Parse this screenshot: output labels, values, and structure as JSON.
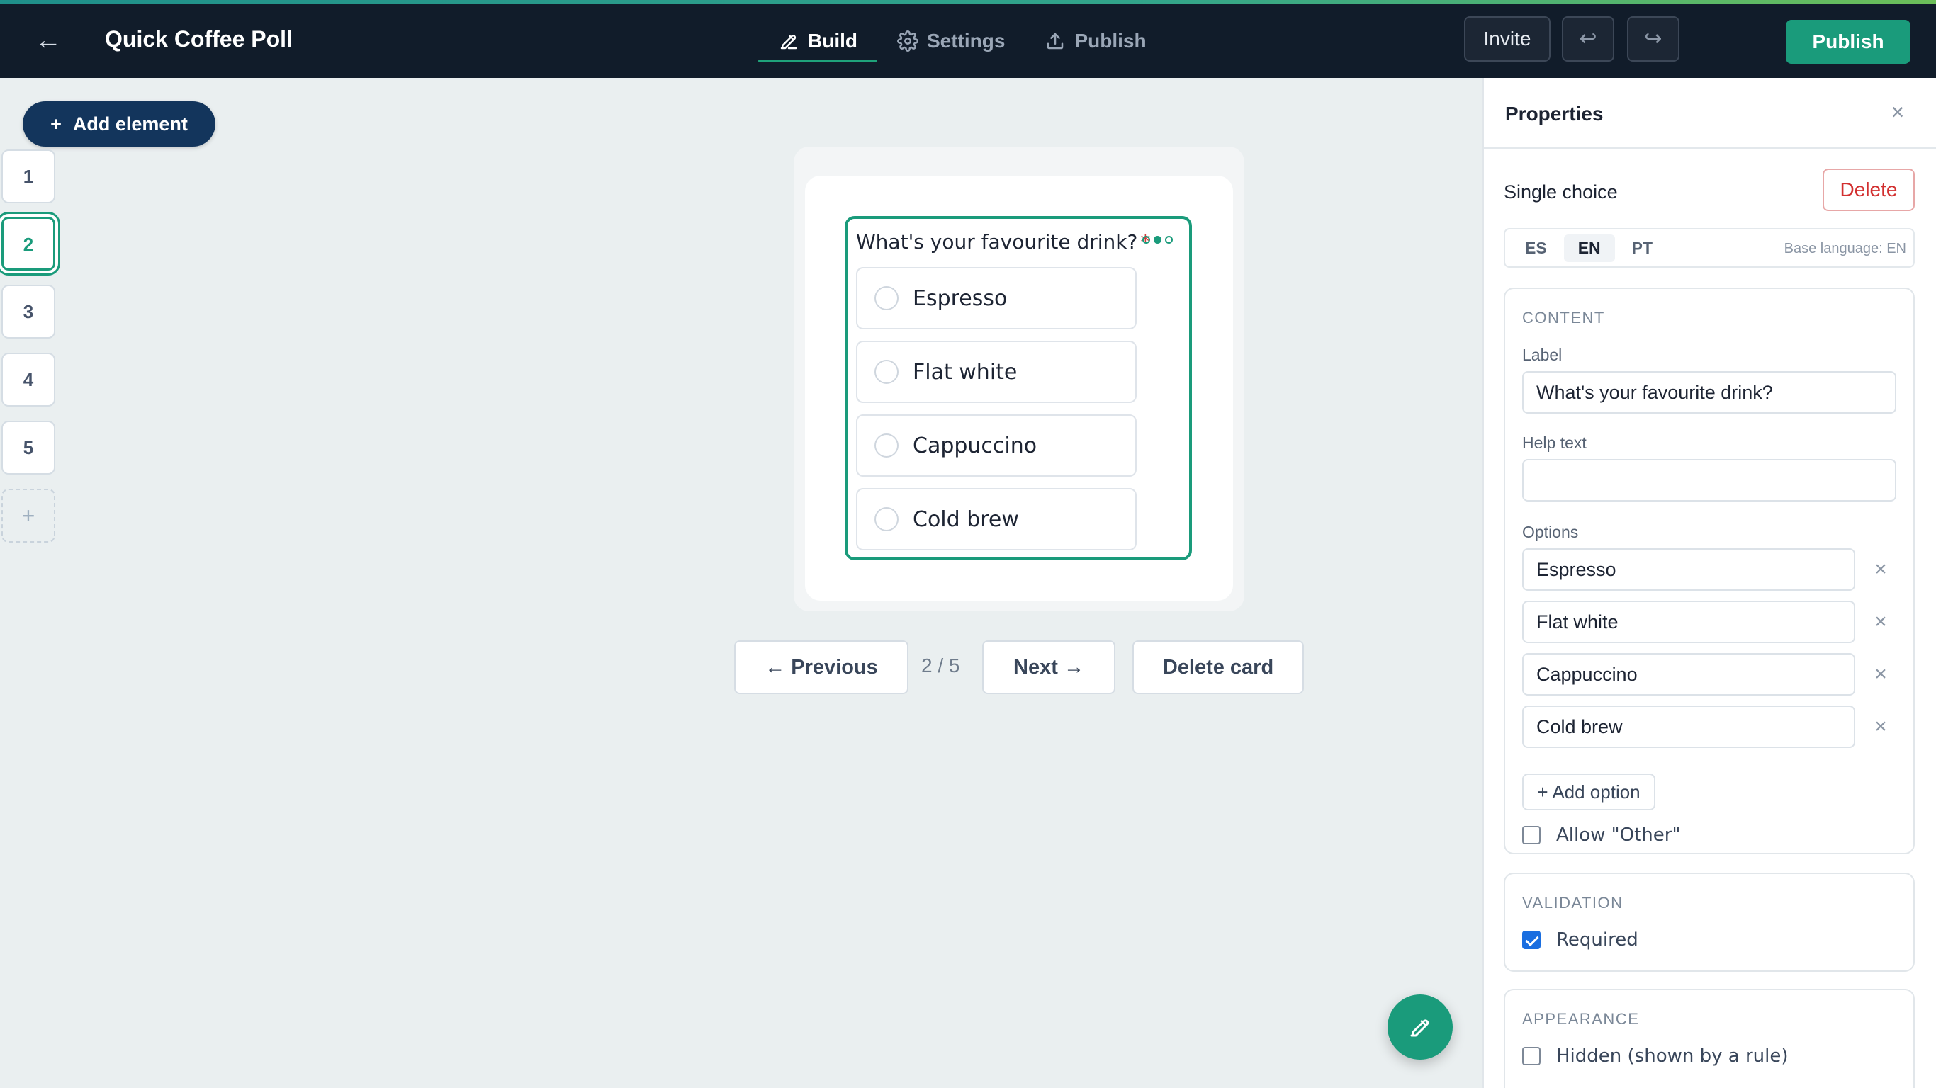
{
  "header": {
    "title": "Quick Coffee Poll",
    "back_icon": "←",
    "tabs": [
      {
        "label": "Build",
        "icon": "pencil-icon",
        "active": true
      },
      {
        "label": "Settings",
        "icon": "gear-icon",
        "active": false
      },
      {
        "label": "Publish",
        "icon": "upload-icon",
        "active": false
      }
    ],
    "invite_label": "Invite",
    "undo_icon": "↩",
    "redo_icon": "↪",
    "publish_label": "Publish",
    "accent_color": "#1a9b7b"
  },
  "left_rail": {
    "add_element_label": "Add element",
    "add_element_plus": "+",
    "cards": [
      "1",
      "2",
      "3",
      "4",
      "5"
    ],
    "selected_card": "2",
    "add_card_plus": "+"
  },
  "canvas": {
    "question": "What's your favourite drink?",
    "required_mark": "*",
    "options": [
      "Espresso",
      "Flat white",
      "Cappuccino",
      "Cold brew"
    ],
    "nav": {
      "previous_label": "← Previous",
      "page_indicator": "2 / 5",
      "next_label": "Next →",
      "delete_card_label": "Delete card"
    }
  },
  "panel": {
    "title": "Properties",
    "close_icon": "×",
    "element_type": "Single choice",
    "delete_label": "Delete",
    "languages": [
      "ES",
      "EN",
      "PT"
    ],
    "active_language": "EN",
    "base_language": "Base language: EN",
    "content": {
      "section_title": "CONTENT",
      "label_title": "Label",
      "label_value": "What's your favourite drink?",
      "help_title": "Help text",
      "help_value": "",
      "options_title": "Options",
      "options": [
        "Espresso",
        "Flat white",
        "Cappuccino",
        "Cold brew"
      ],
      "remove_icon": "×",
      "add_option_label": "+ Add option",
      "allow_other_label": "Allow \"Other\"",
      "allow_other_checked": false
    },
    "validation": {
      "section_title": "VALIDATION",
      "required_label": "Required",
      "required_checked": true
    },
    "appearance": {
      "section_title": "APPEARANCE",
      "hidden_label": "Hidden (shown by a rule)",
      "hidden_checked": false
    }
  }
}
